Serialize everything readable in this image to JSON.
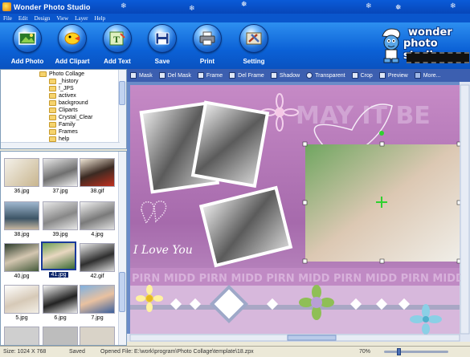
{
  "window": {
    "title": "Wonder Photo Studio"
  },
  "menu": [
    "File",
    "Edit",
    "Design",
    "View",
    "Layer",
    "Help"
  ],
  "toolbar": {
    "buttons": [
      {
        "label": "Add Photo",
        "icon": "add-photo-icon"
      },
      {
        "label": "Add Clipart",
        "icon": "add-clipart-icon"
      },
      {
        "label": "Add Text",
        "icon": "add-text-icon"
      },
      {
        "label": "Save",
        "icon": "save-icon"
      },
      {
        "label": "Print",
        "icon": "print-icon"
      },
      {
        "label": "Setting",
        "icon": "setting-icon"
      }
    ],
    "logo_line1": "wonder",
    "logo_line2": "photo studio"
  },
  "folder_tree": {
    "items": [
      "Photo Collage",
      "_history",
      "!_JPS",
      "activex",
      "background",
      "Cliparts",
      "Crystal_Clear",
      "Family",
      "Frames",
      "help"
    ]
  },
  "thumbnails": [
    "36.jpg",
    "37.jpg",
    "38.gif",
    "38.jpg",
    "39.jpg",
    "4.jpg",
    "40.jpg",
    "41.jpg",
    "42.gif",
    "5.jpg",
    "6.jpg",
    "7.jpg"
  ],
  "selected_thumbnail": "41.jpg",
  "canvas_toolbar": [
    "Mask",
    "Del Mask",
    "Frame",
    "Del Frame",
    "Shadow",
    "Transparent",
    "Crop",
    "Preview",
    "More..."
  ],
  "canvas": {
    "title_text": "MAY IT BE",
    "love_text": "I Love You",
    "band_text": "PIRN MIDD PIRN MIDD PIRN MIDD PIRN MIDD PIRN MIDD"
  },
  "status": {
    "size": "Size: 1024 X 768",
    "state": "Saved",
    "opened_file": "Opened File: E:\\work\\program\\Photo Collage\\template\\18.zpx",
    "zoom": "70%",
    "zoom_fraction": 0.2
  },
  "colors": {
    "accent": "#0a56cc",
    "canvas_bg": "#b06cb0",
    "selection": "#0a246a"
  }
}
